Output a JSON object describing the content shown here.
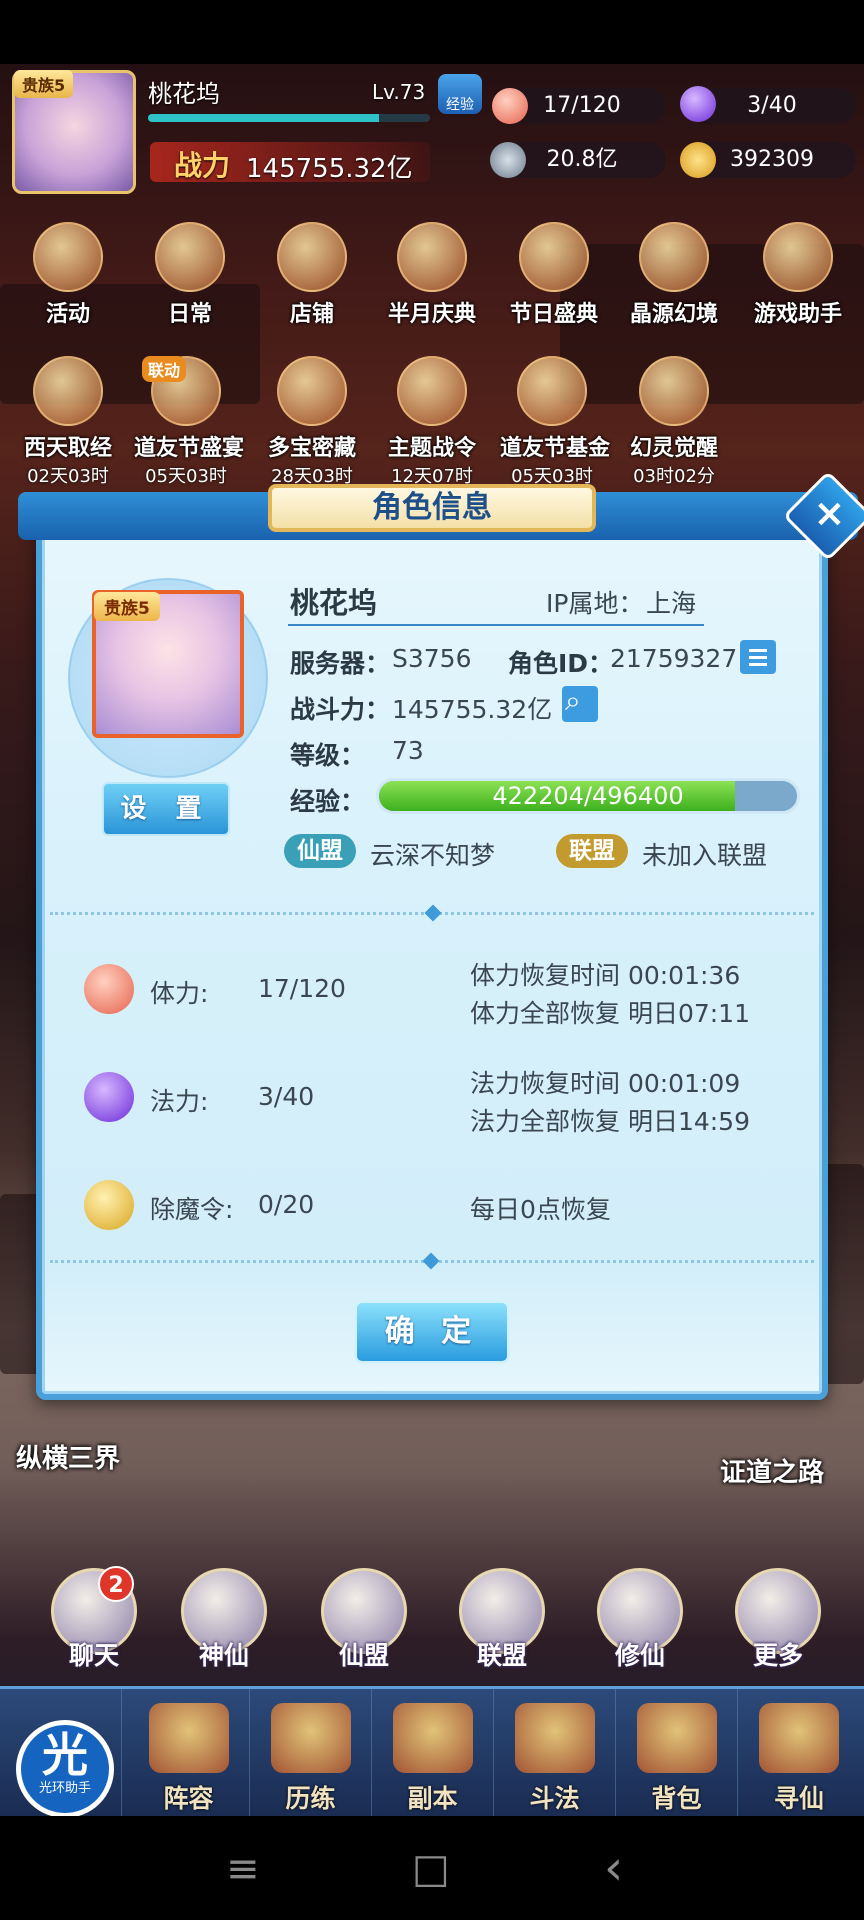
{
  "hud": {
    "vip": "贵族5",
    "name": "桃花坞",
    "level": "Lv.73",
    "exp_badge": "经验",
    "power_label": "战力",
    "power_value": "145755.32亿",
    "stamina": "17/120",
    "mana": "3/40",
    "silver": "20.8亿",
    "gold": "392309",
    "exp_progress_pct": 82
  },
  "activities_row1": [
    {
      "label": "活动"
    },
    {
      "label": "日常"
    },
    {
      "label": "店铺"
    },
    {
      "label": "半月庆典"
    },
    {
      "label": "节日盛典"
    },
    {
      "label": "晶源幻境"
    },
    {
      "label": "游戏助手"
    }
  ],
  "activities_row2": [
    {
      "label": "西天取经",
      "timer": "02天03时"
    },
    {
      "label": "道友节盛宴",
      "timer": "05天03时",
      "badge": "联动"
    },
    {
      "label": "多宝密藏",
      "timer": "28天03时"
    },
    {
      "label": "主题战令",
      "timer": "12天07时"
    },
    {
      "label": "道友节基金",
      "timer": "05天03时"
    },
    {
      "label": "幻灵觉醒",
      "timer": "03时02分"
    }
  ],
  "dialog": {
    "title": "角色信息",
    "close": "×",
    "vip": "贵族5",
    "settings_button": "设 置",
    "name": "桃花坞",
    "ip_label": "IP属地：",
    "ip_value": "上海",
    "server_label": "服务器：",
    "server_value": "S3756",
    "role_id_label": "角色ID：",
    "role_id_value": "21759327",
    "combat_label": "战斗力：",
    "combat_value": "145755.32亿",
    "level_label": "等级：",
    "level_value": "73",
    "exp_label": "经验：",
    "exp_text": "422204/496400",
    "exp_fraction": 0.8505,
    "guild_tag": "仙盟",
    "guild_name": "云深不知梦",
    "alliance_tag": "联盟",
    "alliance_name": "未加入联盟",
    "stamina_label": "体力:",
    "stamina_value": "17/120",
    "stamina_recover": "体力恢复时间 00:01:36",
    "stamina_full": "体力全部恢复 明日07:11",
    "mana_label": "法力:",
    "mana_value": "3/40",
    "mana_recover": "法力恢复时间 00:01:09",
    "mana_full": "法力全部恢复 明日14:59",
    "token_label": "除魔令:",
    "token_value": "0/20",
    "token_recover": "每日0点恢复",
    "confirm_button": "确 定"
  },
  "scene": {
    "left_label": "纵横三界",
    "right_label": "证道之路"
  },
  "round_buttons": [
    {
      "label": "聊天"
    },
    {
      "label": "神仙"
    },
    {
      "label": "仙盟"
    },
    {
      "label": "联盟"
    },
    {
      "label": "修仙"
    },
    {
      "label": "更多"
    }
  ],
  "chat_badge": "2",
  "nav": [
    {
      "label": "阵容"
    },
    {
      "label": "历练"
    },
    {
      "label": "副本"
    },
    {
      "label": "斗法"
    },
    {
      "label": "背包"
    },
    {
      "label": "寻仙"
    }
  ],
  "helper": {
    "big": "光",
    "small": "光环助手"
  },
  "system": {
    "menu": "≡",
    "home": "□",
    "back": "‹"
  }
}
